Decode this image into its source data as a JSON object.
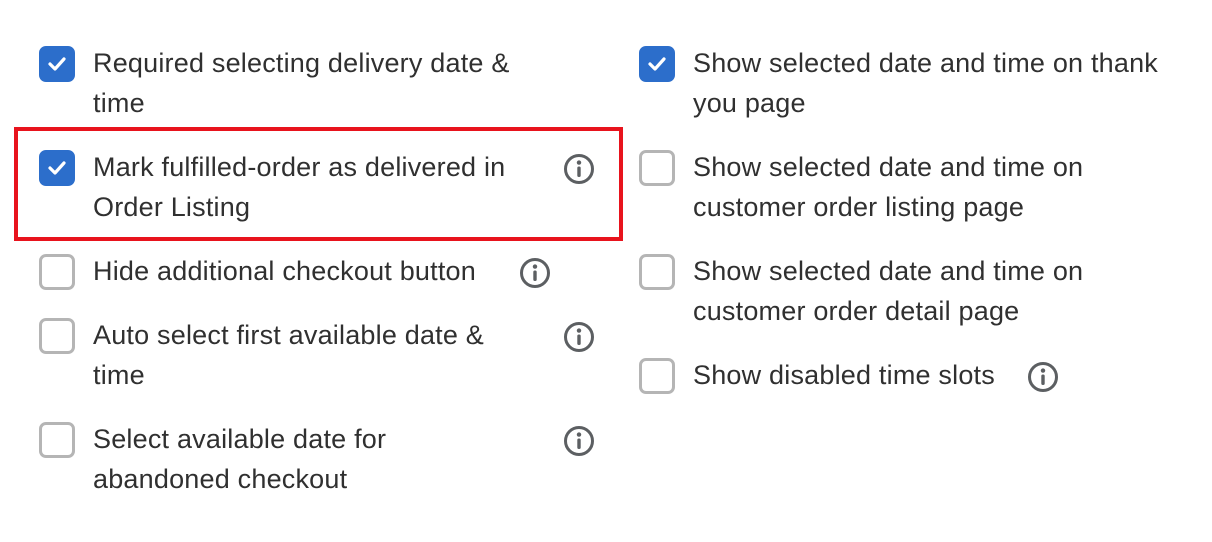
{
  "left_column": [
    {
      "label": "Required selecting delivery date & time",
      "line1": "Required selecting delivery date &",
      "line2": "time",
      "checked": true,
      "info_icon": false
    },
    {
      "label": "Mark fulfilled-order as delivered in Order Listing",
      "line1": "Mark fulfilled-order as delivered in",
      "line2": "Order Listing",
      "checked": true,
      "info_icon": true,
      "highlighted": true
    },
    {
      "label": "Hide additional checkout button",
      "line1": "Hide additional checkout button",
      "checked": false,
      "info_icon": true
    },
    {
      "label": "Auto select first available date & time",
      "line1": "Auto select first available date &",
      "line2": "time",
      "checked": false,
      "info_icon": true
    },
    {
      "label": "Select available date for abandoned checkout",
      "line1": "Select available date for",
      "line2": "abandoned checkout",
      "checked": false,
      "info_icon": true
    }
  ],
  "right_column": [
    {
      "label": "Show selected date and time on thank you page",
      "line1": "Show selected date and time on thank",
      "line2": "you page",
      "checked": true,
      "info_icon": false
    },
    {
      "label": "Show selected date and time on customer order listing page",
      "line1": "Show selected date and time on",
      "line2": "customer order listing page",
      "checked": false,
      "info_icon": false
    },
    {
      "label": "Show selected date and time on customer order detail page",
      "line1": "Show selected date and time on",
      "line2": "customer order detail page",
      "checked": false,
      "info_icon": false
    },
    {
      "label": "Show disabled time slots",
      "line1": "Show disabled time slots",
      "checked": false,
      "info_icon": true
    }
  ],
  "icons": {
    "checkmark": "checkmark-icon",
    "info": "info-icon"
  },
  "colors": {
    "checked_fill": "#2c6ecb",
    "unchecked_border": "#b5b5b5",
    "text": "#303030",
    "highlight_border": "#e8131d",
    "info_icon": "#5c5f62"
  }
}
